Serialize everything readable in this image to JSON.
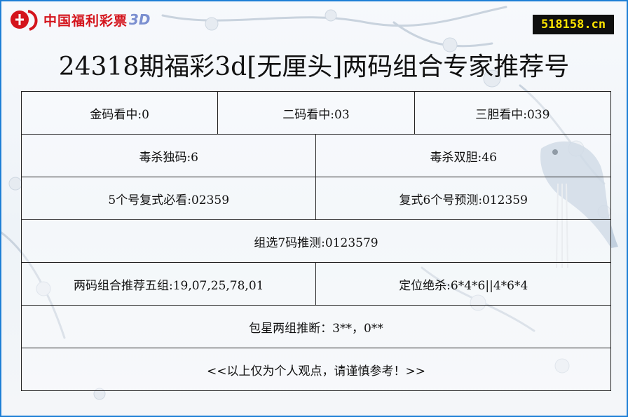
{
  "header": {
    "logo_text": "中国福利彩票",
    "logo_3d": "3D",
    "site_badge": "518158.cn"
  },
  "title": "24318期福彩3d[无厘头]两码组合专家推荐号",
  "rows": [
    [
      "金码看中:0",
      "二码看中:03",
      "三胆看中:039"
    ],
    [
      "毒杀独码:6",
      "毒杀双胆:46"
    ],
    [
      "5个号复式必看:02359",
      "复式6个号预测:012359"
    ],
    [
      "组选7码推测:0123579"
    ],
    [
      "两码组合推荐五组:19,07,25,78,01",
      "定位绝杀:6*4*6||4*6*4"
    ],
    [
      "包星两组推断：3**，0**"
    ],
    [
      "<<以上仅为个人观点，请谨慎参考！>>"
    ]
  ],
  "colors": {
    "border": "#1e7fd6",
    "logo_red": "#d4141c",
    "badge_bg": "#0f0f0f",
    "badge_text": "#ffe400"
  }
}
